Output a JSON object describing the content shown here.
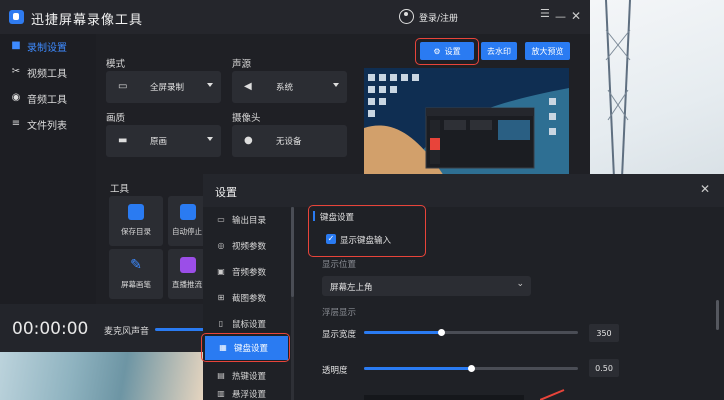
{
  "app": {
    "title": "迅捷屏幕录像工具",
    "login": "登录/注册",
    "icons": [
      "logo-icon",
      "user-icon",
      "menu-icon",
      "minimize-icon",
      "close-icon"
    ]
  },
  "sidebar": {
    "items": [
      {
        "label": "录制设置",
        "icon": "camera-icon",
        "active": true
      },
      {
        "label": "视频工具",
        "icon": "scissors-icon"
      },
      {
        "label": "音频工具",
        "icon": "audio-icon"
      },
      {
        "label": "文件列表",
        "icon": "list-icon"
      }
    ]
  },
  "record": {
    "mode_label": "模式",
    "mode_value": "全屏录制",
    "audio_label": "声源",
    "audio_value": "系统",
    "quality_label": "画质",
    "quality_value": "原画",
    "camera_label": "摄像头",
    "camera_value": "无设备",
    "tools_label": "工具",
    "tools": [
      {
        "label": "保存目录",
        "icon": "save-folder-icon"
      },
      {
        "label": "自动停止",
        "icon": "auto-stop-icon"
      },
      {
        "label": "屏幕画笔",
        "icon": "brush-icon"
      },
      {
        "label": "直播推流",
        "icon": "live-icon"
      }
    ]
  },
  "topbuttons": {
    "settings": "设置",
    "watermark": "去水印",
    "preview": "放大预览"
  },
  "bottom": {
    "timer": "00:00:00",
    "mic_label": "麦克风声音"
  },
  "dialog": {
    "title": "设置",
    "nav": [
      {
        "label": "输出目录",
        "icon": "folder-icon"
      },
      {
        "label": "视频参数",
        "icon": "video-icon"
      },
      {
        "label": "音频参数",
        "icon": "audio-param-icon"
      },
      {
        "label": "截图参数",
        "icon": "screenshot-icon"
      },
      {
        "label": "鼠标设置",
        "icon": "mouse-icon"
      },
      {
        "label": "键盘设置",
        "icon": "keyboard-icon",
        "active": true
      },
      {
        "label": "热键设置",
        "icon": "hotkey-icon"
      },
      {
        "label": "悬浮设置",
        "icon": "float-icon"
      }
    ],
    "section_title": "键盘设置",
    "show_keyboard": {
      "label": "显示键盘输入",
      "checked": true
    },
    "position_label": "显示位置",
    "position_value": "屏幕左上角",
    "float_label": "浮层显示",
    "width_label": "显示宽度",
    "width_value": "350",
    "width_fraction": 0.36,
    "opacity_label": "透明度",
    "opacity_value": "0.50",
    "opacity_fraction": 0.5
  },
  "colors": {
    "accent": "#2a7bf2",
    "highlight": "#e8443a",
    "panel": "#1f2025"
  }
}
